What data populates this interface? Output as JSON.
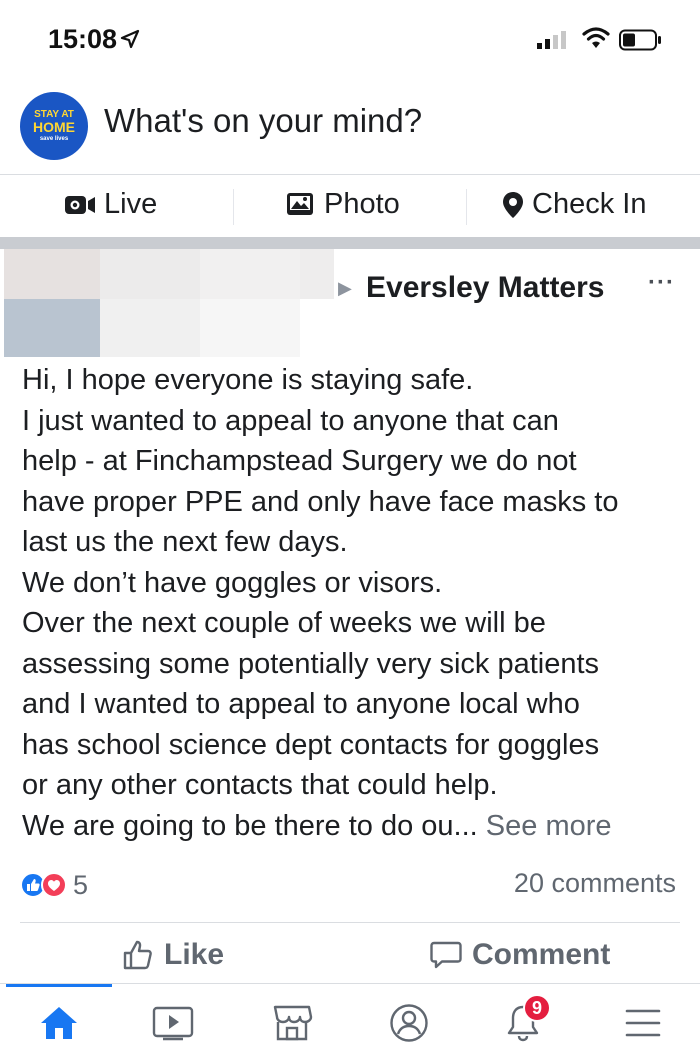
{
  "status_bar": {
    "time": "15:08"
  },
  "composer": {
    "avatar_line1": "STAY AT",
    "avatar_line2": "HOME",
    "avatar_line3": "save lives",
    "placeholder": "What's on your mind?"
  },
  "composer_actions": {
    "live": "Live",
    "photo": "Photo",
    "check_in": "Check In"
  },
  "post": {
    "group_name": "Eversley Matters",
    "more": "···",
    "lines": [
      "Hi, I hope everyone is staying safe.",
      "I just wanted to appeal to anyone that can",
      "help - at Finchampstead Surgery we do not",
      "have proper PPE and only have face masks to",
      "last us the next few days.",
      "We don’t have goggles or visors.",
      "Over the next couple of weeks we will be",
      "assessing some potentially very sick patients",
      "and I wanted to appeal to anyone local who",
      "has school science dept contacts for goggles",
      "or any other contacts that could help."
    ],
    "last_line": "We are going to be there to do ou...",
    "see_more": "See more",
    "reaction_count": "5",
    "comments": "20 comments",
    "like_label": "Like",
    "comment_label": "Comment"
  },
  "tabbar": {
    "notification_badge": "9"
  },
  "colors": {
    "accent": "#1877f2",
    "badge": "#e41e3f",
    "muted": "#606770"
  }
}
